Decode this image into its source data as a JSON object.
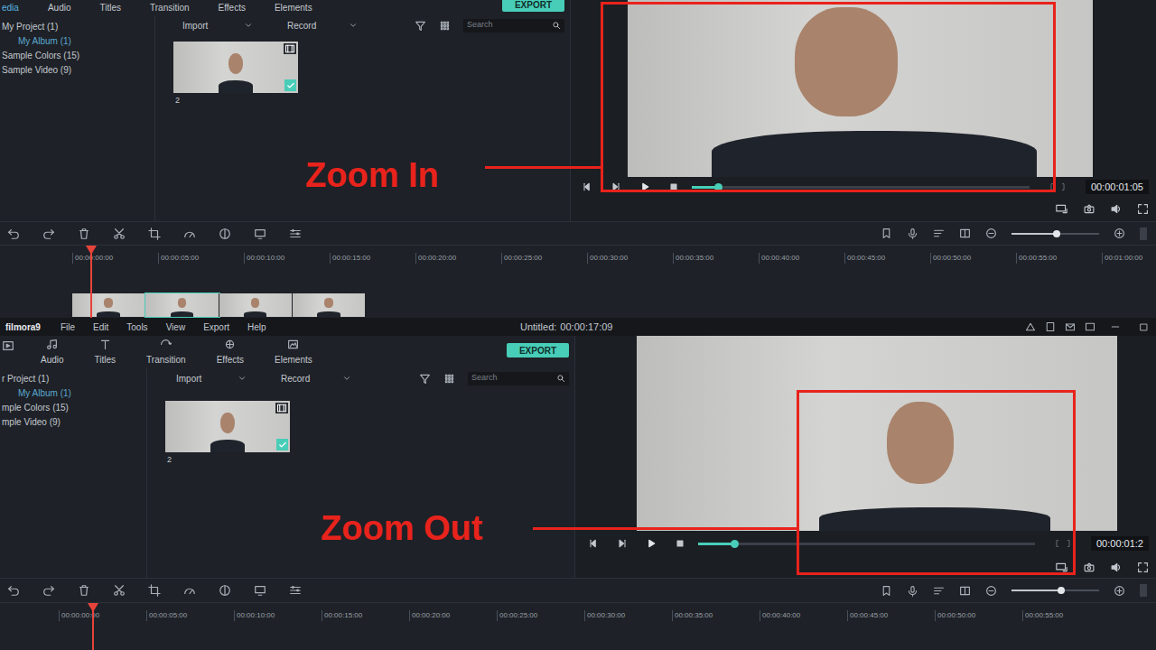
{
  "top_window": {
    "tabs": [
      {
        "label": "edia",
        "selected": true
      },
      {
        "label": "Audio",
        "selected": false
      },
      {
        "label": "Titles",
        "selected": false
      },
      {
        "label": "Transition",
        "selected": false
      },
      {
        "label": "Effects",
        "selected": false
      },
      {
        "label": "Elements",
        "selected": false
      }
    ],
    "export_button": "EXPORT",
    "sidebar": [
      {
        "label": "My Project (1)",
        "kind": "folder",
        "selected": false
      },
      {
        "label": "My Album (1)",
        "kind": "subfolder",
        "selected": true
      },
      {
        "label": "Sample Colors (15)",
        "kind": "folder",
        "selected": false
      },
      {
        "label": "Sample Video (9)",
        "kind": "folder",
        "selected": false
      }
    ],
    "media_toolbar": {
      "import": "Import",
      "record": "Record",
      "search_placeholder": "Search"
    },
    "clips": [
      {
        "label": "2",
        "checked": true
      }
    ],
    "preview": {
      "timecode": "00:00:01:05",
      "progress": 0.08
    },
    "zoom_slider": 0.52,
    "ruler": [
      "00:00:00:00",
      "00:00:05:00",
      "00:00:10:00",
      "00:00:15:00",
      "00:00:20:00",
      "00:00:25:00",
      "00:00:30:00",
      "00:00:35:00",
      "00:00:40:00",
      "00:00:45:00",
      "00:00:50:00",
      "00:00:55:00",
      "00:01:00:00"
    ],
    "playhead": 0.078,
    "annotation": "Zoom In"
  },
  "bottom_window": {
    "title_bar": {
      "logo": "filmora9",
      "menu": [
        "File",
        "Edit",
        "Tools",
        "View",
        "Export",
        "Help"
      ],
      "project": "Untitled:",
      "duration": "00:00:17:09"
    },
    "tabs": [
      {
        "label": "Audio",
        "selected": false
      },
      {
        "label": "Titles",
        "selected": false
      },
      {
        "label": "Transition",
        "selected": false
      },
      {
        "label": "Effects",
        "selected": false
      },
      {
        "label": "Elements",
        "selected": false
      }
    ],
    "export_button": "EXPORT",
    "sidebar": [
      {
        "label": "r Project (1)",
        "kind": "folder",
        "selected": false
      },
      {
        "label": "My Album (1)",
        "kind": "subfolder",
        "selected": true
      },
      {
        "label": "mple Colors (15)",
        "kind": "folder",
        "selected": false
      },
      {
        "label": "mple Video (9)",
        "kind": "folder",
        "selected": false
      }
    ],
    "media_toolbar": {
      "import": "Import",
      "record": "Record",
      "search_placeholder": "Search"
    },
    "clips": [
      {
        "label": "2",
        "checked": true
      }
    ],
    "preview": {
      "timecode": "00:00:01:2",
      "progress": 0.11
    },
    "zoom_slider": 0.57,
    "ruler": [
      "00:00:00:00",
      "00:00:05:00",
      "00:00:10:00",
      "00:00:15:00",
      "00:00:20:00",
      "00:00:25:00",
      "00:00:30:00",
      "00:00:35:00",
      "00:00:40:00",
      "00:00:45:00",
      "00:00:50:00",
      "00:00:55:00"
    ],
    "playhead": 0.08,
    "annotation": "Zoom Out"
  }
}
